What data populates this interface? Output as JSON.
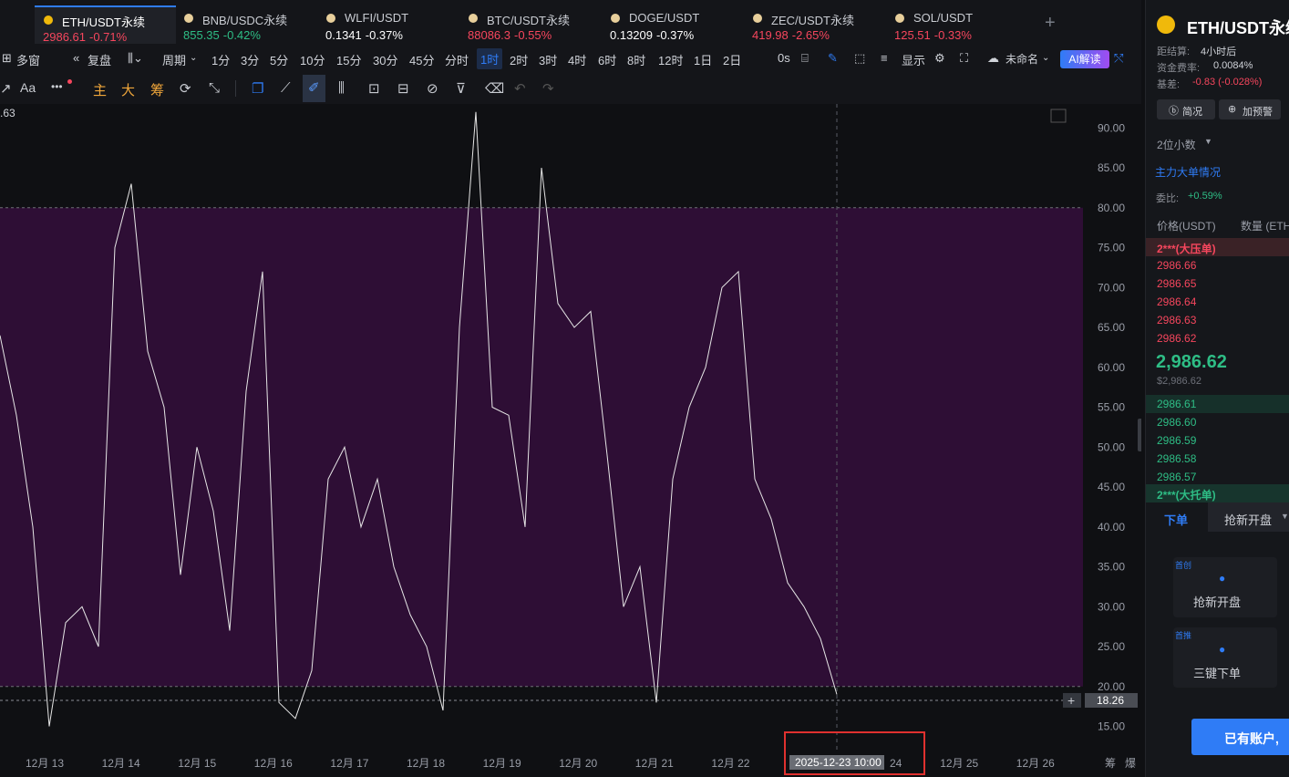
{
  "tabs": [
    {
      "name": "ETH/USDT永续",
      "price": "2986.61",
      "change": "-0.71%",
      "dir": "down",
      "active": true
    },
    {
      "name": "BNB/USDC永续",
      "price": "855.35",
      "change": "-0.42%",
      "dir": "up"
    },
    {
      "name": "WLFI/USDT",
      "price": "0.1341",
      "change": "-0.37%",
      "dir": "white"
    },
    {
      "name": "BTC/USDT永续",
      "price": "88086.3",
      "change": "-0.55%",
      "dir": "down"
    },
    {
      "name": "DOGE/USDT",
      "price": "0.13209",
      "change": "-0.37%",
      "dir": "white"
    },
    {
      "name": "ZEC/USDT永续",
      "price": "419.98",
      "change": "-2.65%",
      "dir": "down"
    },
    {
      "name": "SOL/USDT",
      "price": "125.51",
      "change": "-0.33%",
      "dir": "down"
    }
  ],
  "add_tab": "+",
  "toolbar": {
    "multiwindow": "多窗",
    "replay": "复盘",
    "period": "周期",
    "intervals": [
      "1分",
      "3分",
      "5分",
      "10分",
      "15分",
      "30分",
      "45分",
      "分时",
      "1时",
      "2时",
      "3时",
      "4时",
      "6时",
      "8时",
      "12时",
      "1日",
      "2日"
    ],
    "active_interval": "1时",
    "countdown": "0s",
    "display": "显示",
    "unnamed": "未命名",
    "ai": "AI解读"
  },
  "toolbar2": {
    "font": "Aa",
    "more": "•••",
    "main": "主",
    "big": "大",
    "chip": "筹"
  },
  "chart": {
    "top_left_value": ".63",
    "current_value_label": "18.26",
    "crosshair_time": "2025-12-23 10:00",
    "after_crosshair": "24",
    "bottom_right": [
      "筹",
      "爆"
    ],
    "y_ticks": [
      "90.00",
      "85.00",
      "80.00",
      "75.00",
      "70.00",
      "65.00",
      "60.00",
      "55.00",
      "50.00",
      "45.00",
      "40.00",
      "35.00",
      "30.00",
      "25.00",
      "20.00",
      "15.00"
    ],
    "x_ticks": [
      "12月 13",
      "12月 14",
      "12月 15",
      "12月 16",
      "12月 17",
      "12月 18",
      "12月 19",
      "12月 20",
      "12月 21",
      "12月 22",
      "12月 25",
      "12月 26"
    ]
  },
  "chart_data": {
    "type": "line",
    "title": "",
    "ylim": [
      13,
      93
    ],
    "band": [
      20,
      80
    ],
    "current_value": 18.26,
    "x": [
      "12-12 12:00",
      "12-12 18:00",
      "12-13 00:00",
      "12-13 06:00",
      "12-13 12:00",
      "12-13 18:00",
      "12-14 00:00",
      "12-14 06:00",
      "12-14 12:00",
      "12-14 18:00",
      "12-15 00:00",
      "12-15 06:00",
      "12-15 12:00",
      "12-15 18:00",
      "12-16 00:00",
      "12-16 06:00",
      "12-16 12:00",
      "12-16 18:00",
      "12-17 00:00",
      "12-17 06:00",
      "12-17 12:00",
      "12-17 18:00",
      "12-18 00:00",
      "12-18 06:00",
      "12-18 12:00",
      "12-18 18:00",
      "12-19 00:00",
      "12-19 06:00",
      "12-19 12:00",
      "12-19 18:00",
      "12-20 00:00",
      "12-20 06:00",
      "12-20 12:00",
      "12-20 18:00",
      "12-21 00:00",
      "12-21 06:00",
      "12-21 12:00",
      "12-21 18:00",
      "12-22 00:00",
      "12-22 06:00",
      "12-22 12:00",
      "12-22 18:00",
      "12-23 00:00",
      "12-23 06:00",
      "12-23 10:00"
    ],
    "series": [
      {
        "values": [
          64,
          54,
          40,
          15,
          28,
          30,
          25,
          75,
          83,
          62,
          55,
          34,
          50,
          42,
          27,
          57,
          72,
          18,
          16,
          22,
          46,
          50,
          40,
          46,
          35,
          29,
          25,
          17,
          65,
          92,
          55,
          54,
          40,
          85,
          68,
          65,
          67,
          49,
          30,
          35,
          18,
          46,
          55,
          60,
          70,
          72,
          46,
          41,
          33,
          30,
          26,
          19
        ]
      }
    ]
  },
  "panel": {
    "title": "ETH/USDT永续",
    "settle_label": "距结算:",
    "settle_val": "4小时后",
    "funding_label": "资金费率:",
    "funding_val": "0.0084%",
    "basis_label": "基差:",
    "basis_val": "-0.83 (-0.028%)",
    "brief_btn": "简况",
    "alert_btn": "加预警",
    "decimals": "2位小数",
    "big_orders": "主力大单情况",
    "ratio_label": "委比:",
    "ratio_val": "+0.59%",
    "col_price": "价格(USDT)",
    "col_qty": "数量 (ETH",
    "big_ask": "2***(大压单)",
    "asks": [
      "2986.66",
      "2986.65",
      "2986.64",
      "2986.63",
      "2986.62"
    ],
    "last_price": "2,986.62",
    "last_price_sub": "$2,986.62",
    "bids": [
      "2986.61",
      "2986.60",
      "2986.59",
      "2986.58",
      "2986.57"
    ],
    "big_bid": "2***(大托单)",
    "order_tab": "下单",
    "rush_tab": "抢新开盘",
    "badge1": "首创",
    "card1": "抢新开盘",
    "badge2": "首推",
    "card2": "三键下单",
    "account_btn": "已有账户,"
  }
}
